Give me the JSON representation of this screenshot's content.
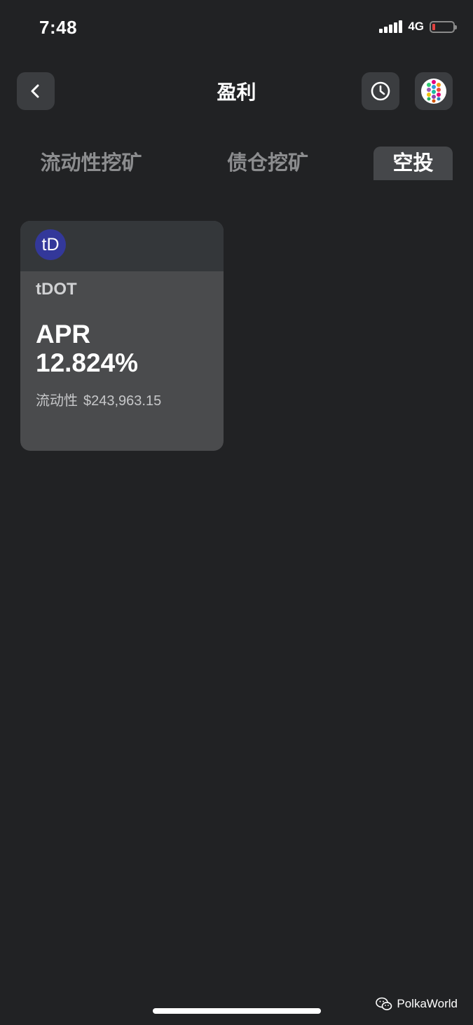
{
  "status_bar": {
    "time": "7:48",
    "network": "4G"
  },
  "header": {
    "title": "盈利",
    "back_icon": "chevron-left-icon",
    "history_icon": "clock-icon",
    "account_icon": "polkadot-avatar-icon"
  },
  "tabs": [
    {
      "label": "流动性挖矿",
      "active": false
    },
    {
      "label": "债仓挖矿",
      "active": false
    },
    {
      "label": "空投",
      "active": true
    }
  ],
  "cards": [
    {
      "icon_text": "tD",
      "token": "tDOT",
      "apr_label": "APR",
      "apr_value": "12.824%",
      "liquidity_label": "流动性",
      "liquidity_value": "$243,963.15"
    }
  ],
  "watermark": {
    "text": "PolkaWorld",
    "icon": "wechat-icon"
  },
  "colors": {
    "background": "#212224",
    "button_bg": "#3b3d40",
    "card_bg": "#4a4b4d",
    "card_header_bg": "#34373a",
    "token_icon_bg": "#33389a",
    "tab_inactive": "#8c8d8f",
    "battery_low": "#e2423f"
  }
}
